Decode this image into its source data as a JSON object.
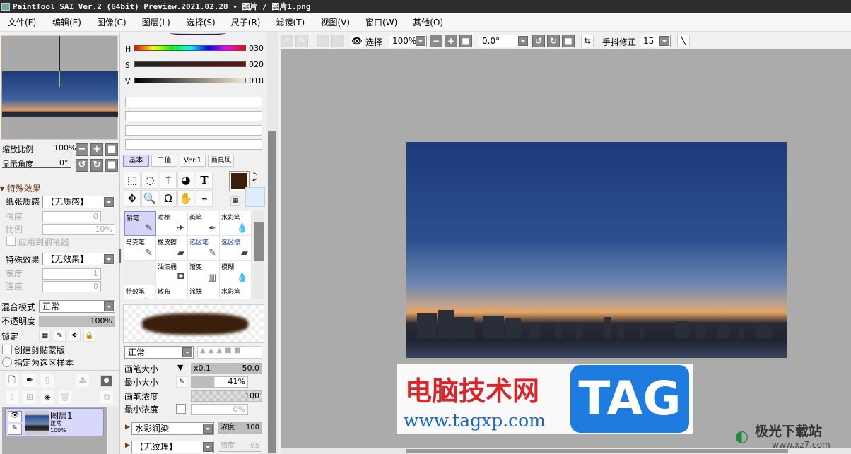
{
  "window": {
    "title": "PaintTool SAI Ver.2 (64bit) Preview.2021.02.28 - 图片 / 图片1.png"
  },
  "menu": [
    "文件(F)",
    "编辑(E)",
    "图像(C)",
    "图层(L)",
    "选择(S)",
    "尺子(R)",
    "滤镜(T)",
    "视图(V)",
    "窗口(W)",
    "其他(O)"
  ],
  "navigator": {
    "zoom_label": "缩放比例",
    "zoom_value": "100%",
    "angle_label": "显示角度",
    "angle_value": "0°"
  },
  "effects": {
    "section": "特殊效果",
    "paper_label": "纸张质感",
    "paper_value": "【无质感】",
    "strength_label": "强度",
    "strength_value": "0",
    "scale_label": "比例",
    "scale_value": "10%",
    "apply_pen": "应用到钢笔线",
    "effect_label": "特殊效果",
    "effect_value": "【无效果】",
    "width_label": "宽度",
    "width_value": "1",
    "strength2_label": "强度",
    "strength2_value": "0"
  },
  "layer": {
    "blend_label": "混合模式",
    "blend_value": "正常",
    "opacity_label": "不透明度",
    "opacity_value": "100%",
    "lock_label": "锁定",
    "clip": "创建剪贴蒙版",
    "sample": "指定为选区样本",
    "items": [
      {
        "name": "图层1",
        "mode": "正常",
        "opacity": "100%"
      }
    ]
  },
  "color": {
    "h_label": "H",
    "h": "030",
    "s_label": "S",
    "s": "020",
    "v_label": "V",
    "v": "018",
    "fg": "#3a1f0a",
    "bg": "#ddeeff"
  },
  "tool_tabs": [
    "基本",
    "二值",
    "Ver.1",
    "画具风"
  ],
  "brushes": [
    "铅笔",
    "喷枪",
    "画笔",
    "水彩笔",
    "马克笔",
    "橡皮擦",
    "选区笔",
    "选区擦",
    "",
    "油漆桶",
    "渐变",
    "模糊",
    "特效笔",
    "散布",
    "涂抹",
    "水彩笔"
  ],
  "brush_settings": {
    "mode": "正常",
    "size_label": "画笔大小",
    "size_mult": "x0.1",
    "size": "50.0",
    "min_size_label": "最小大小",
    "min_size": "41%",
    "density_label": "画笔浓度",
    "density": "100",
    "min_density_label": "最小浓度",
    "min_density": "0%",
    "mix": "水彩润染",
    "mix_label": "浓度",
    "mix_value": "100",
    "texture": "【无纹理】",
    "texture_label": "强度",
    "texture_value": "95"
  },
  "toolbar": {
    "select_label": "选择",
    "zoom": "100%",
    "angle": "0.0°",
    "stabilizer_label": "手抖修正",
    "stabilizer": "15"
  },
  "watermark": {
    "site_cn": "电脑技术网",
    "tag": "TAG",
    "url": "www.tagxp.com",
    "corner": "极光下载站",
    "corner_url": "www.xz7.com"
  }
}
